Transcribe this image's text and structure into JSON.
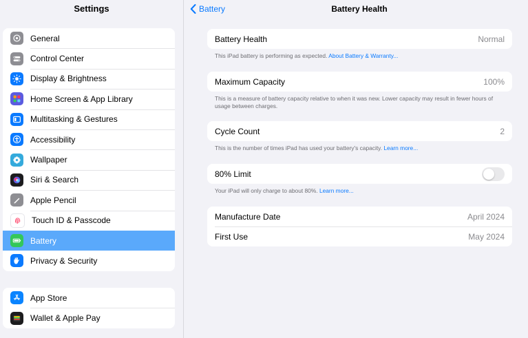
{
  "sidebar": {
    "title": "Settings",
    "groups": [
      {
        "items": [
          {
            "label": "General",
            "icon": "gear-icon",
            "color": "#8e8e93"
          },
          {
            "label": "Control Center",
            "icon": "control-center-icon",
            "color": "#8e8e93"
          },
          {
            "label": "Display & Brightness",
            "icon": "sun-icon",
            "color": "#0a7aff"
          },
          {
            "label": "Home Screen & App Library",
            "icon": "app-grid-icon",
            "color": "#5b5be0"
          },
          {
            "label": "Multitasking & Gestures",
            "icon": "multitasking-icon",
            "color": "#0a7aff"
          },
          {
            "label": "Accessibility",
            "icon": "accessibility-icon",
            "color": "#0a7aff"
          },
          {
            "label": "Wallpaper",
            "icon": "flower-icon",
            "color": "#34aadc"
          },
          {
            "label": "Siri & Search",
            "icon": "siri-icon",
            "color": "#1c1c1e"
          },
          {
            "label": "Apple Pencil",
            "icon": "pencil-icon",
            "color": "#8e8e93"
          },
          {
            "label": "Touch ID & Passcode",
            "icon": "fingerprint-icon",
            "color": "#ffffff"
          },
          {
            "label": "Battery",
            "icon": "battery-icon",
            "color": "#34c759",
            "selected": true
          },
          {
            "label": "Privacy & Security",
            "icon": "hand-icon",
            "color": "#0a7aff"
          }
        ]
      },
      {
        "items": [
          {
            "label": "App Store",
            "icon": "app-store-icon",
            "color": "#0a84ff"
          },
          {
            "label": "Wallet & Apple Pay",
            "icon": "wallet-icon",
            "color": "#1c1c1e"
          }
        ]
      }
    ]
  },
  "header": {
    "back_label": "Battery",
    "title": "Battery Health"
  },
  "sections": {
    "health": {
      "label": "Battery Health",
      "value": "Normal",
      "footer": "This iPad battery is performing as expected. ",
      "link": "About Battery & Warranty..."
    },
    "capacity": {
      "label": "Maximum Capacity",
      "value": "100%",
      "footer": "This is a measure of battery capacity relative to when it was new. Lower capacity may result in fewer hours of usage between charges."
    },
    "cycles": {
      "label": "Cycle Count",
      "value": "2",
      "footer": "This is the number of times iPad has used your battery's capacity. ",
      "link": "Learn more..."
    },
    "limit": {
      "label": "80% Limit",
      "on": false,
      "footer": "Your iPad will only charge to about 80%. ",
      "link": "Learn more..."
    },
    "dates": {
      "manufacture_label": "Manufacture Date",
      "manufacture_value": "April 2024",
      "first_use_label": "First Use",
      "first_use_value": "May 2024"
    }
  }
}
